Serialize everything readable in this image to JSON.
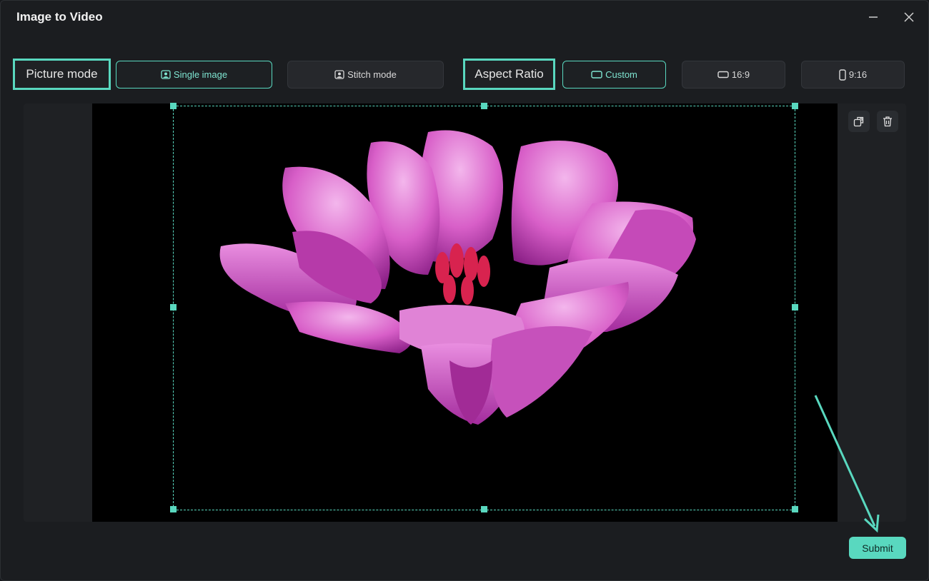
{
  "window": {
    "title": "Image to Video"
  },
  "picture_mode": {
    "label": "Picture mode",
    "options": [
      {
        "label": "Single image",
        "selected": true,
        "icon": "portrait-image-icon"
      },
      {
        "label": "Stitch mode",
        "selected": false,
        "icon": "portrait-image-icon"
      }
    ]
  },
  "aspect_ratio": {
    "label": "Aspect Ratio",
    "options": [
      {
        "label": "Custom",
        "selected": true,
        "icon": "custom-ratio-icon"
      },
      {
        "label": "16:9",
        "selected": false,
        "icon": "landscape-ratio-icon"
      },
      {
        "label": "9:16",
        "selected": false,
        "icon": "portrait-ratio-icon"
      }
    ]
  },
  "canvas": {
    "tools": [
      "replace-icon",
      "trash-icon"
    ]
  },
  "submit_label": "Submit",
  "colors": {
    "accent": "#59d8bf",
    "background": "#1b1d20",
    "flower": "#c73fb3"
  }
}
